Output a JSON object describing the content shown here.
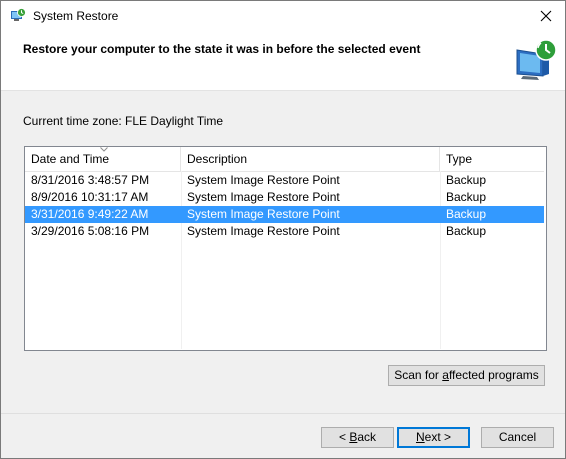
{
  "window": {
    "title": "System Restore"
  },
  "header": {
    "title": "Restore your computer to the state it was in before the selected event"
  },
  "timezone": {
    "label": "Current time zone: FLE Daylight Time"
  },
  "table": {
    "columns": [
      "Date and Time",
      "Description",
      "Type"
    ],
    "rows": [
      {
        "date": "8/31/2016 3:48:57 PM",
        "description": "System Image Restore Point",
        "type": "Backup"
      },
      {
        "date": "8/9/2016 10:31:17 AM",
        "description": "System Image Restore Point",
        "type": "Backup"
      },
      {
        "date": "3/31/2016 9:49:22 AM",
        "description": "System Image Restore Point",
        "type": "Backup"
      },
      {
        "date": "3/29/2016 5:08:16 PM",
        "description": "System Image Restore Point",
        "type": "Backup"
      }
    ],
    "selected_row": 2
  },
  "buttons": {
    "scan_prefix": "Scan for ",
    "scan_accel": "a",
    "scan_suffix": "ffected programs",
    "back_prefix": "< ",
    "back_accel": "B",
    "back_suffix": "ack",
    "next_accel": "N",
    "next_suffix": "ext >",
    "cancel": "Cancel"
  },
  "colors": {
    "selection": "#3399ff",
    "default_button_border": "#0078d7"
  },
  "icons": {
    "app": "system-restore-icon",
    "header": "restore-monitor-icon",
    "close": "close-icon",
    "sort": "sort-arrow-icon"
  }
}
